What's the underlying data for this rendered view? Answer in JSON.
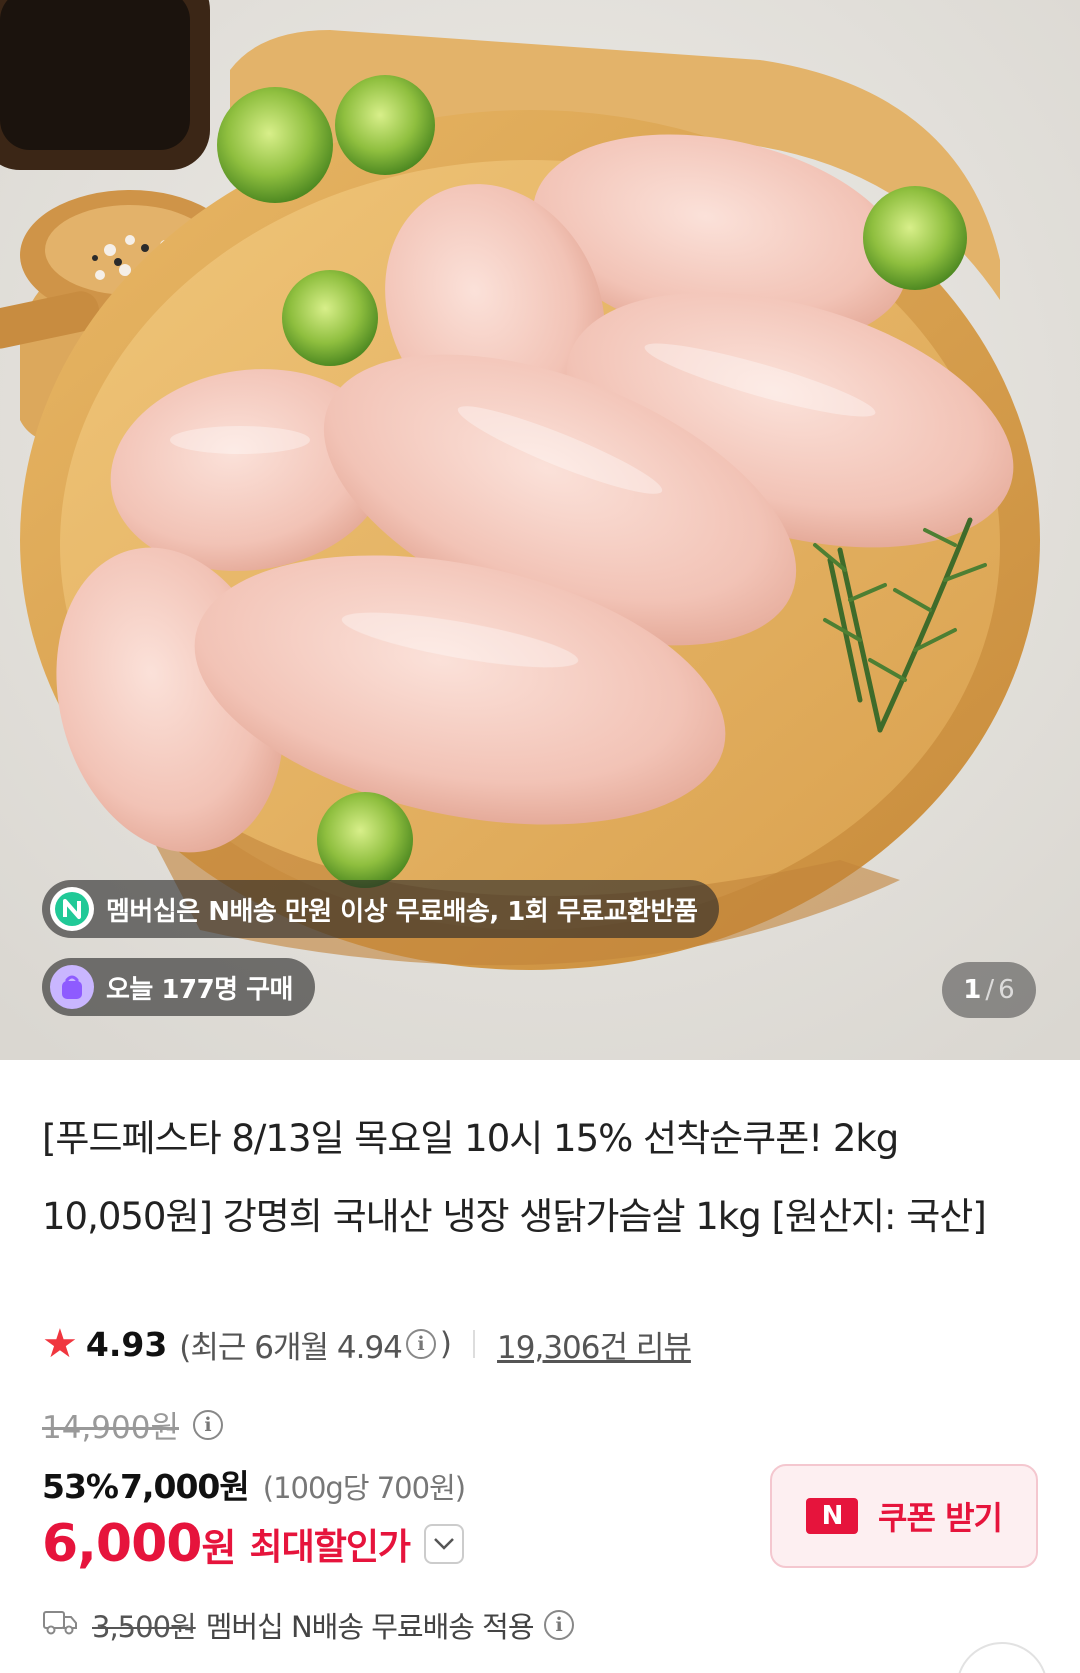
{
  "gallery": {
    "current": "1",
    "separator": "/",
    "total": "6"
  },
  "badges": {
    "membership_text": "멤버십은 N배송 만원 이상 무료배송, 1회 무료교환반품",
    "buyers_text": "오늘 177명 구매"
  },
  "product": {
    "title": "[푸드페스타 8/13일 목요일 10시 15% 선착순쿠폰! 2kg 10,050원] 강명희 국내산 냉장 생닭가슴살 1kg [원산지: 국산]"
  },
  "rating": {
    "score": "4.93",
    "recent_open": "(최근 6개월 4.94",
    "recent_close": ")",
    "reviews": "19,306건 리뷰"
  },
  "price": {
    "original": "14,900원",
    "discount_pct": "53%",
    "sale_price": "7,000원",
    "unit_price": "(100g당 700원)",
    "max_price": "6,000",
    "max_won": "원",
    "max_label": "최대할인가"
  },
  "coupon": {
    "logo": "N",
    "label": "쿠폰 받기"
  },
  "shipping": {
    "original_fee": "3,500원",
    "text": "멤버십 N배송 무료배송 적용"
  },
  "colors": {
    "accent_red": "#e6143c",
    "star": "#f0363f"
  },
  "icons": [
    "n-delivery-icon",
    "shopping-bag-icon",
    "star-icon",
    "info-icon",
    "chevron-down-icon",
    "n-logo-icon",
    "truck-icon"
  ]
}
